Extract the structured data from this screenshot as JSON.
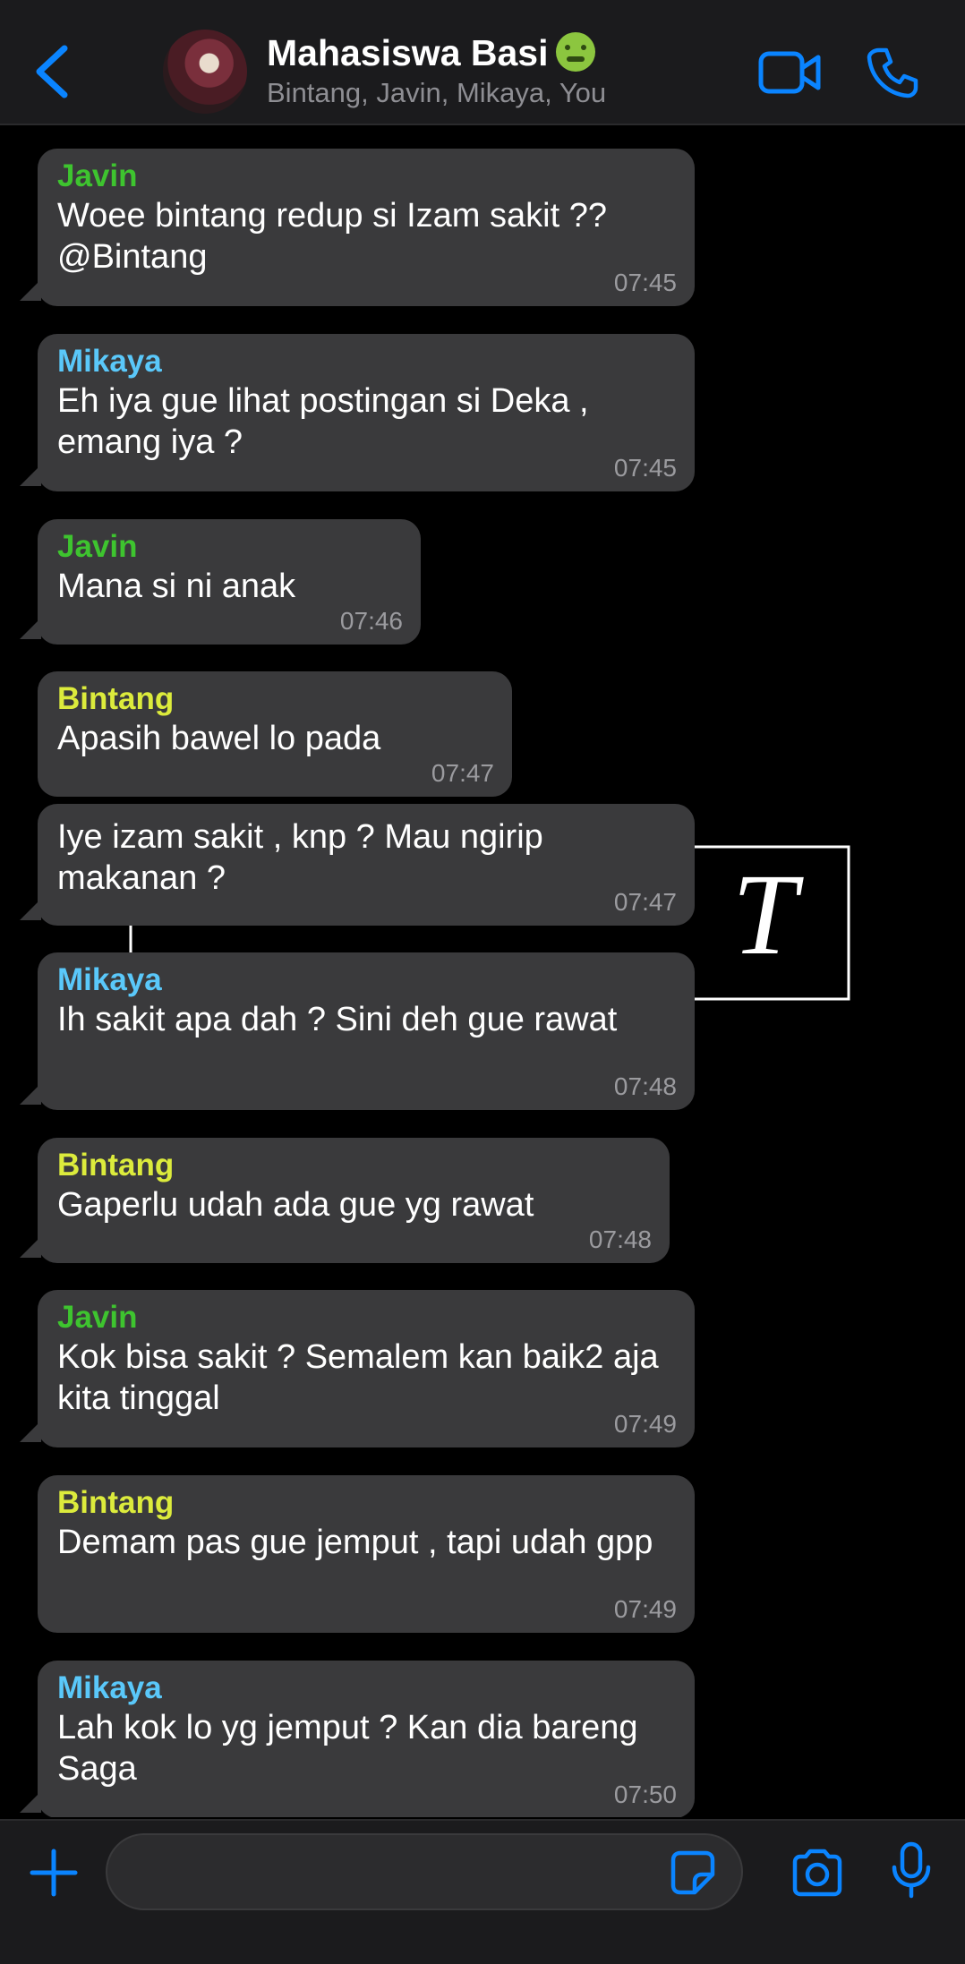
{
  "header": {
    "back_icon": "chevron-left-icon",
    "group_name": "Mahasiswa Basi",
    "group_emoji": "nauseated-face-emoji",
    "members": "Bintang, Javin, Mikaya, You",
    "video_icon": "video-camera-icon",
    "call_icon": "phone-icon"
  },
  "colors": {
    "accent": "#0a84ff",
    "bubble": "#3a3a3c",
    "javin": "#3ec42f",
    "mikaya": "#5ac8fa",
    "bintang": "#dceb3c"
  },
  "wallpaper": {
    "letter": "T"
  },
  "messages": [
    {
      "sender": "Javin",
      "text": "Woee bintang redup si Izam sakit ?? @Bintang",
      "time": "07:45"
    },
    {
      "sender": "Mikaya",
      "text": "Eh iya gue lihat postingan si Deka , emang iya ?",
      "time": "07:45"
    },
    {
      "sender": "Javin",
      "text": "Mana si ni anak",
      "time": "07:46"
    },
    {
      "sender": "Bintang",
      "text": "Apasih bawel lo pada",
      "time": "07:47"
    },
    {
      "sender": "",
      "text": "Iye izam sakit , knp ? Mau ngirip makanan ?",
      "time": "07:47"
    },
    {
      "sender": "Mikaya",
      "text": "Ih sakit apa dah ? Sini deh gue rawat",
      "time": "07:48"
    },
    {
      "sender": "Bintang",
      "text": "Gaperlu udah ada gue yg rawat",
      "time": "07:48"
    },
    {
      "sender": "Javin",
      "text": "Kok bisa sakit ? Semalem kan baik2 aja kita tinggal",
      "time": "07:49"
    },
    {
      "sender": "Bintang",
      "text": "Demam pas gue jemput , tapi udah gpp",
      "time": "07:49"
    },
    {
      "sender": "Mikaya",
      "text": "Lah kok lo yg jemput ? Kan dia bareng Saga",
      "time": "07:50"
    }
  ],
  "input_bar": {
    "plus_icon": "plus-icon",
    "message_placeholder": "",
    "sticker_icon": "sticker-icon",
    "camera_icon": "camera-icon",
    "mic_icon": "microphone-icon"
  }
}
